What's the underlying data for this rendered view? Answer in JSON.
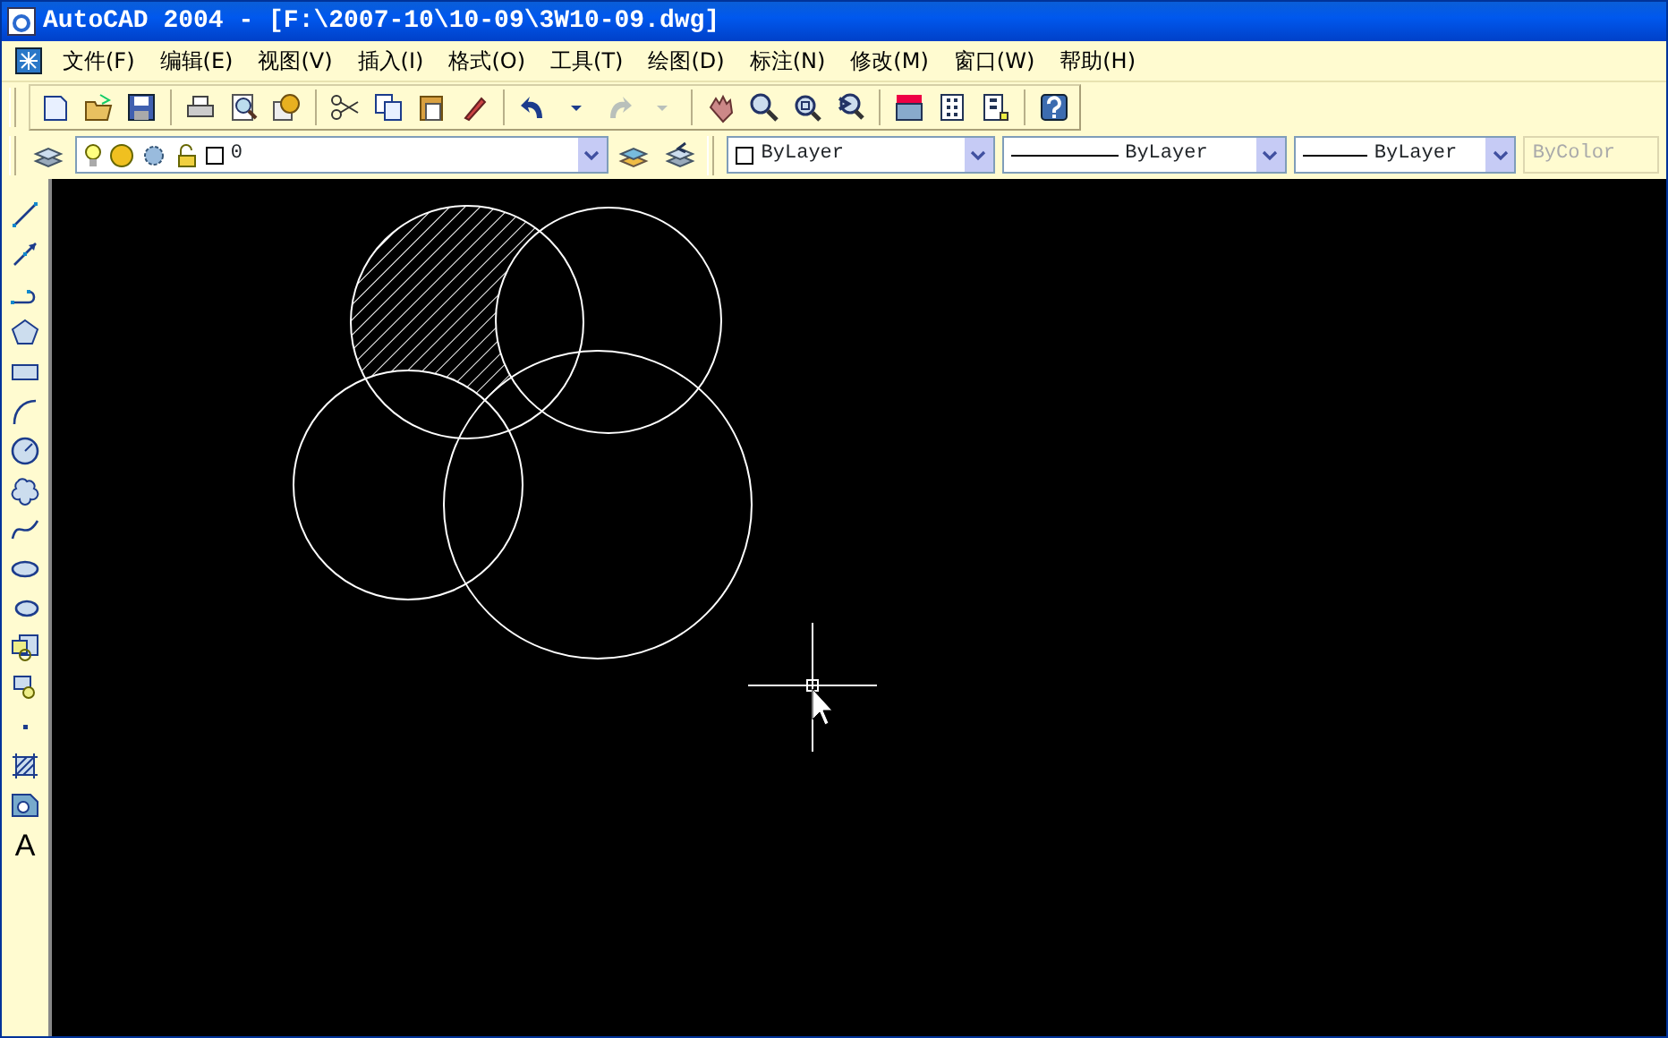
{
  "window": {
    "title": "AutoCAD 2004 - [F:\\2007-10\\10-09\\3W10-09.dwg]"
  },
  "menu": [
    {
      "label": "文件(F)"
    },
    {
      "label": "编辑(E)"
    },
    {
      "label": "视图(V)"
    },
    {
      "label": "插入(I)"
    },
    {
      "label": "格式(O)"
    },
    {
      "label": "工具(T)"
    },
    {
      "label": "绘图(D)"
    },
    {
      "label": "标注(N)"
    },
    {
      "label": "修改(M)"
    },
    {
      "label": "窗口(W)"
    },
    {
      "label": "帮助(H)"
    }
  ],
  "standard_toolbar": {
    "redo_disabled": true
  },
  "properties_toolbar": {
    "layer": "0",
    "color_setting": "ByLayer",
    "linetype": "ByLayer",
    "lineweight": "ByLayer",
    "plot_style": {
      "value": "ByColor",
      "disabled": true
    }
  },
  "draw_toolbar": {
    "text_tool_label": "A"
  }
}
